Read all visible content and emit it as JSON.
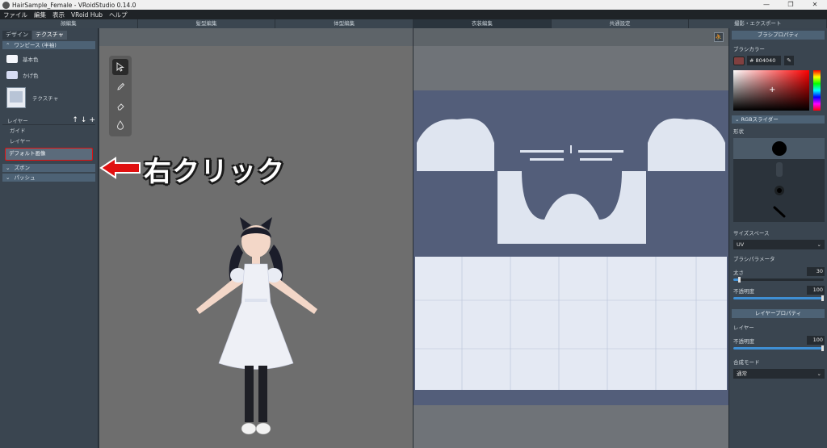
{
  "window": {
    "title": "HairSample_Female - VRoidStudio 0.14.0",
    "controls": [
      "—",
      "❐",
      "✕"
    ]
  },
  "menu": [
    "ファイル",
    "編集",
    "表示",
    "VRoid Hub",
    "ヘルプ"
  ],
  "mode_tabs": [
    {
      "label": "顔編集",
      "active": false
    },
    {
      "label": "髪型編集",
      "active": false
    },
    {
      "label": "体型編集",
      "active": false
    },
    {
      "label": "衣装編集",
      "active": true
    },
    {
      "label": "共通設定",
      "active": false
    },
    {
      "label": "撮影・エクスポート",
      "active": false
    }
  ],
  "left_panel": {
    "tabs": [
      "デザイン",
      "テクスチャ"
    ],
    "section_onepiece": "ワンピース (半袖)",
    "color_base": {
      "label": "基本色",
      "color": "#f4f6fb"
    },
    "color_shadow": {
      "label": "かげ色",
      "color": "#d6dcf3"
    },
    "texture_label": "テクスチャ",
    "layer_label": "レイヤー",
    "layer_buttons": [
      "↑",
      "↓",
      "+"
    ],
    "layers": [
      "ガイド",
      "レイヤー",
      "デフォルト画像"
    ],
    "section_pants": "ズボン",
    "section_shoes": "パッシュ"
  },
  "annotation": {
    "text": "右クリック",
    "color": "#e01010"
  },
  "right_panel": {
    "brush_header": "ブラシプロパティ",
    "brush_color_label": "ブラシカラー",
    "brush_hex": "# 804040",
    "brush_color": "#804040",
    "rgb_slider_label": "RGBスライダー",
    "shape_label": "形状",
    "size_space_label": "サイズスペース",
    "size_space_value": "UV",
    "brush_param_label": "ブラシパラメータ",
    "thickness_label": "太さ",
    "thickness_value": "30",
    "thickness_fraction": 0.08,
    "opacity_label": "不透明度",
    "opacity_value": "100",
    "opacity_fraction": 1.0,
    "layer_header": "レイヤープロパティ",
    "layer_label": "レイヤー",
    "layer_opacity_label": "不透明度",
    "layer_opacity_value": "100",
    "layer_opacity_fraction": 1.0,
    "blend_label": "合成モード",
    "blend_value": "通常"
  }
}
